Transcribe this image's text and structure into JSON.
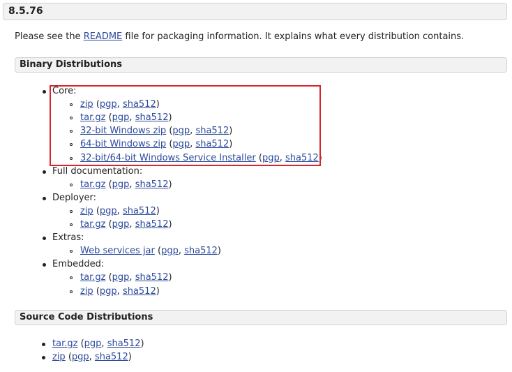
{
  "version": "8.5.76",
  "intro": {
    "before": "Please see the ",
    "link": "README",
    "after": " file for packaging information. It explains what every distribution contains."
  },
  "binary": {
    "title": "Binary Distributions",
    "groups": [
      {
        "label": "Core:",
        "items": [
          {
            "name": "zip",
            "pgp": "pgp",
            "sha": "sha512"
          },
          {
            "name": "tar.gz",
            "pgp": "pgp",
            "sha": "sha512"
          },
          {
            "name": "32-bit Windows zip",
            "pgp": "pgp",
            "sha": "sha512"
          },
          {
            "name": "64-bit Windows zip",
            "pgp": "pgp",
            "sha": "sha512"
          },
          {
            "name": "32-bit/64-bit Windows Service Installer",
            "pgp": "pgp",
            "sha": "sha512"
          }
        ]
      },
      {
        "label": "Full documentation:",
        "items": [
          {
            "name": "tar.gz",
            "pgp": "pgp",
            "sha": "sha512"
          }
        ]
      },
      {
        "label": "Deployer:",
        "items": [
          {
            "name": "zip",
            "pgp": "pgp",
            "sha": "sha512"
          },
          {
            "name": "tar.gz",
            "pgp": "pgp",
            "sha": "sha512"
          }
        ]
      },
      {
        "label": "Extras:",
        "items": [
          {
            "name": "Web services jar",
            "pgp": "pgp",
            "sha": "sha512"
          }
        ]
      },
      {
        "label": "Embedded:",
        "items": [
          {
            "name": "tar.gz",
            "pgp": "pgp",
            "sha": "sha512"
          },
          {
            "name": "zip",
            "pgp": "pgp",
            "sha": "sha512"
          }
        ]
      }
    ]
  },
  "source": {
    "title": "Source Code Distributions",
    "items": [
      {
        "name": "tar.gz",
        "pgp": "pgp",
        "sha": "sha512"
      },
      {
        "name": "zip",
        "pgp": "pgp",
        "sha": "sha512"
      }
    ]
  },
  "punct": {
    "open": " (",
    "comma": ", ",
    "close": ")"
  },
  "colors": {
    "link": "#2c4a9c",
    "highlight": "#d9242e",
    "bar": "#f2f2f2"
  }
}
